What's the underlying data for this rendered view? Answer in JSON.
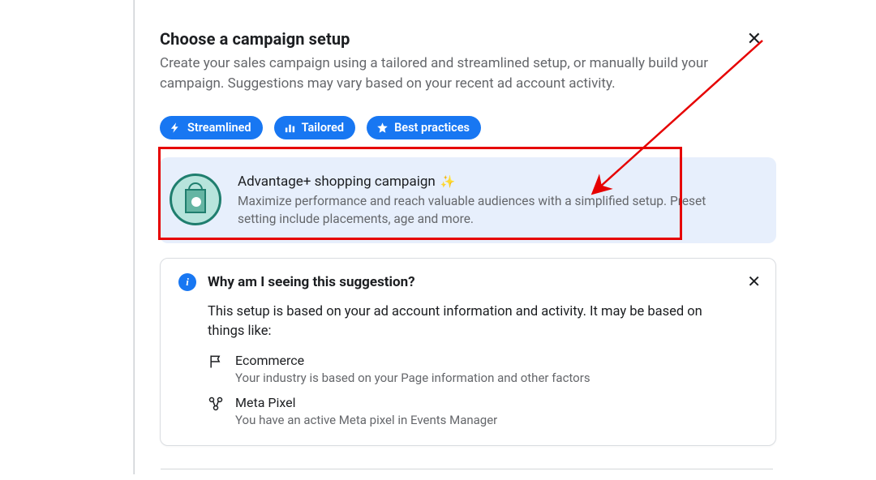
{
  "header": {
    "title": "Choose a campaign setup",
    "description": "Create your sales campaign using a tailored and streamlined setup, or manually build your campaign. Suggestions may vary based on your recent ad account activity."
  },
  "chips": [
    {
      "label": "Streamlined"
    },
    {
      "label": "Tailored"
    },
    {
      "label": "Best practices"
    }
  ],
  "option": {
    "title": "Advantage+ shopping campaign",
    "description": "Maximize performance and reach valuable audiences with a simplified setup. Preset setting include placements, age and more."
  },
  "info": {
    "title": "Why am I seeing this suggestion?",
    "body": "This setup is based on your ad account information and activity. It may be based on things like:",
    "reasons": [
      {
        "title": "Ecommerce",
        "desc": "Your industry is based on your Page information and other factors"
      },
      {
        "title": "Meta Pixel",
        "desc": "You have an active Meta pixel in Events Manager"
      }
    ]
  },
  "annotation": {
    "color": "#e60000"
  }
}
